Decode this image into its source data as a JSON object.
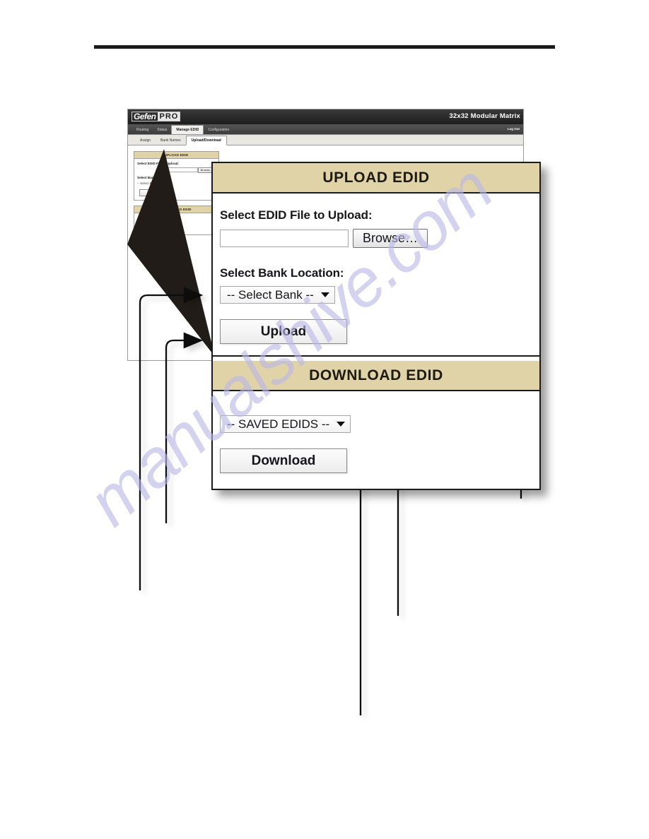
{
  "document": {
    "watermark": "manualshive.com"
  },
  "webapp": {
    "brand": {
      "gefen": "Gefen",
      "pro": "PRO"
    },
    "title": "32x32 Modular Matrix",
    "logout": "Log Out",
    "tabs": [
      {
        "label": "Routing",
        "active": false
      },
      {
        "label": "Status",
        "active": false
      },
      {
        "label": "Manage EDID",
        "active": true
      },
      {
        "label": "Configuration",
        "active": false
      }
    ],
    "subtabs": [
      {
        "label": "Assign",
        "active": false
      },
      {
        "label": "Bank Names",
        "active": false
      },
      {
        "label": "Upload/Download",
        "active": true
      }
    ],
    "upload_panel": {
      "heading": "UPLOAD EDID",
      "file_label": "Select EDID File to Upload:",
      "file_value": "",
      "browse_label": "Browse…",
      "bank_label": "Select Bank Location:",
      "bank_value": "-- Select Bank --",
      "submit_label": "Upload"
    },
    "download_panel": {
      "heading": "DOWNLOAD EDID",
      "saved_value": "-- SAVED EDIDS --",
      "submit_label": "Download"
    }
  },
  "zoom_card": {
    "upload": {
      "heading": "UPLOAD EDID",
      "file_label": "Select EDID File to Upload:",
      "file_value": "",
      "file_placeholder": "",
      "browse_label": "Browse…",
      "bank_label": "Select Bank Location:",
      "bank_selected": "-- Select Bank --",
      "submit_label": "Upload"
    },
    "download": {
      "heading": "DOWNLOAD EDID",
      "saved_selected": "-- SAVED EDIDS --",
      "submit_label": "Download"
    }
  },
  "colors": {
    "panel_header_tan": "#e1d3a8",
    "ink": "#1b1b1b",
    "watermark": "#b9b9e8"
  }
}
